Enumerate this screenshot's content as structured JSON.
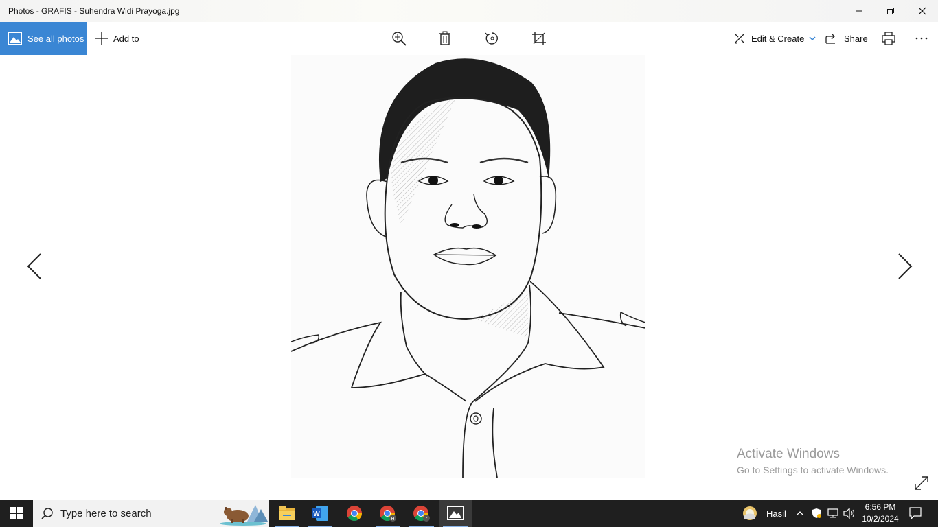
{
  "window": {
    "title": "Photos - GRAFIS - Suhendra Widi Prayoga.jpg"
  },
  "toolbar": {
    "see_all_photos": "See all photos",
    "add_to": "Add to",
    "edit_create": "Edit & Create",
    "share": "Share",
    "icons": [
      "zoom-icon",
      "delete-icon",
      "rotate-icon",
      "crop-icon",
      "print-icon",
      "more-icon"
    ]
  },
  "watermark": {
    "line1": "Activate Windows",
    "line2": "Go to Settings to activate Windows."
  },
  "taskbar": {
    "search_placeholder": "Type here to search",
    "weather_label": "Hasil",
    "time": "6:56 PM",
    "date": "10/2/2024",
    "apps": [
      "file-explorer",
      "microsoft-word",
      "chrome",
      "chrome-profile-h",
      "chrome-profile-r",
      "photos"
    ]
  },
  "colors": {
    "accent": "#3a86d4",
    "taskbar": "#1f1f1f"
  }
}
